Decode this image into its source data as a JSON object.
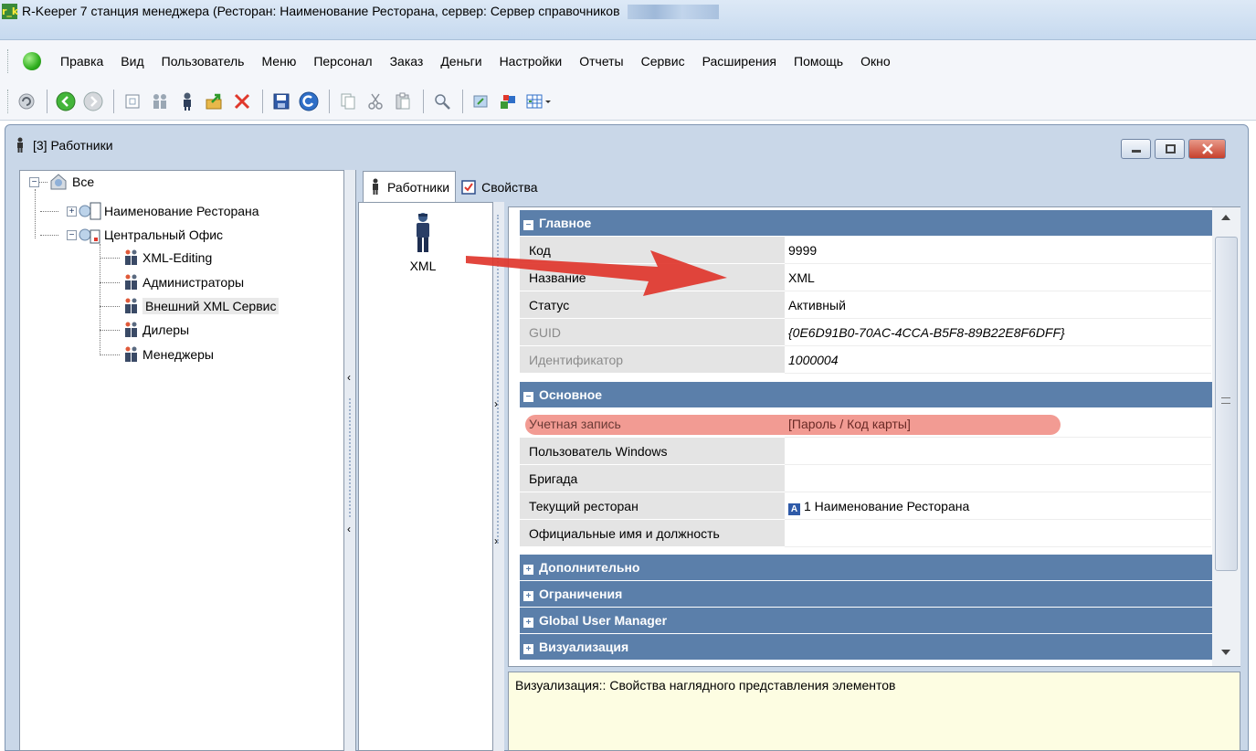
{
  "app": {
    "icon_text": "r_k",
    "title": "R-Keeper 7 станция менеджера (Ресторан: Наименование Ресторана, сервер: Сервер справочников"
  },
  "menu": [
    "Правка",
    "Вид",
    "Пользователь",
    "Меню",
    "Персонал",
    "Заказ",
    "Деньги",
    "Настройки",
    "Отчеты",
    "Сервис",
    "Расширения",
    "Помощь",
    "Окно"
  ],
  "window": {
    "title": "[3] Работники"
  },
  "tree": {
    "root": "Все",
    "items": [
      {
        "label": "Наименование Ресторана"
      },
      {
        "label": "Центральный Офис"
      },
      {
        "label": "XML-Editing"
      },
      {
        "label": "Администраторы"
      },
      {
        "label": "Внешний XML Сервис"
      },
      {
        "label": "Дилеры"
      },
      {
        "label": "Менеджеры"
      }
    ]
  },
  "tabs": [
    {
      "label": "Работники"
    },
    {
      "label": "Свойства"
    }
  ],
  "list": {
    "item_label": "XML"
  },
  "sections": {
    "main": "Главное",
    "basic": "Основное",
    "extra": "Дополнительно",
    "limits": "Ограничения",
    "gum": "Global User Manager",
    "visual": "Визуализация"
  },
  "props": {
    "code": {
      "name": "Код",
      "value": "9999"
    },
    "title": {
      "name": "Название",
      "value": "XML"
    },
    "status": {
      "name": "Статус",
      "value": "Активный"
    },
    "guid": {
      "name": "GUID",
      "value": "{0E6D91B0-70AC-4CCA-B5F8-89B22E8F6DFF}"
    },
    "ident": {
      "name": "Идентификатор",
      "value": "1000004"
    },
    "account": {
      "name": "Учетная запись",
      "value": "[Пароль / Код карты]"
    },
    "win_user": {
      "name": "Пользователь Windows",
      "value": ""
    },
    "brigade": {
      "name": "Бригада",
      "value": ""
    },
    "cur_rest": {
      "name": "Текущий ресторан",
      "value": "1 Наименование Ресторана"
    },
    "official": {
      "name": "Официальные имя и должность",
      "value": ""
    }
  },
  "description": "Визуализация:: Свойства наглядного представления элементов",
  "colors": {
    "section_bg": "#5b7faa",
    "highlight": "#f08a80",
    "arrow": "#e0362c"
  }
}
